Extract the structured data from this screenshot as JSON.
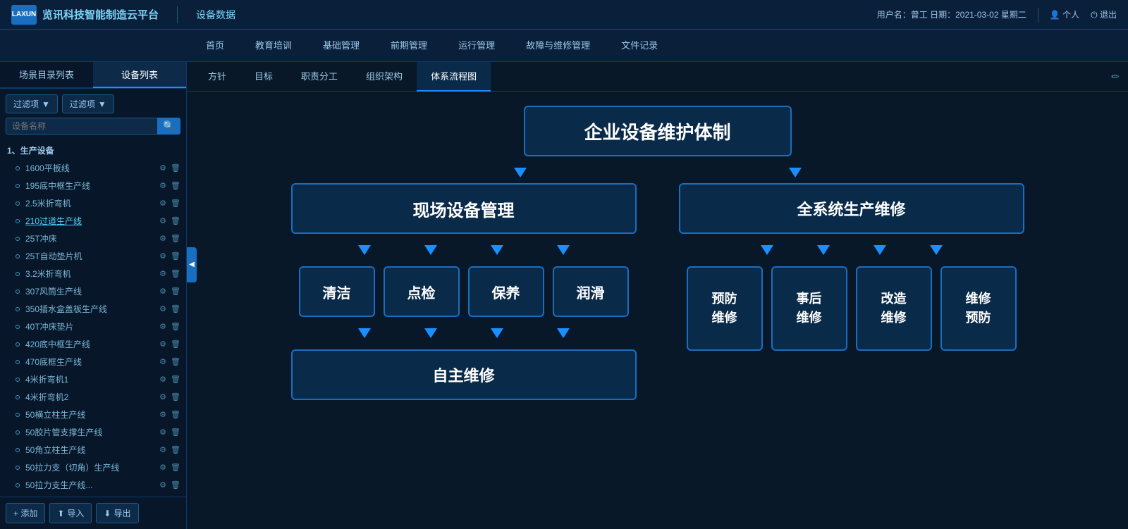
{
  "header": {
    "logo_text": "LAXUN",
    "app_title": "览讯科技智能制造云平台",
    "page_label": "设备数据",
    "user_info": "用户名：曾工  日期：2021-03-02 星期二",
    "personal_label": "个人",
    "logout_label": "退出"
  },
  "nav": {
    "tabs": [
      {
        "label": "首页",
        "active": false
      },
      {
        "label": "教育培训",
        "active": false
      },
      {
        "label": "基础管理",
        "active": false
      },
      {
        "label": "前期管理",
        "active": false
      },
      {
        "label": "运行管理",
        "active": false
      },
      {
        "label": "故障与维修管理",
        "active": false
      },
      {
        "label": "文件记录",
        "active": false
      }
    ]
  },
  "sidebar": {
    "filter1_label": "过滤项",
    "filter2_label": "过滤项",
    "search_placeholder": "设备名称",
    "group_label": "1、生产设备",
    "items": [
      {
        "name": "1600平板线"
      },
      {
        "name": "195底中框生产线"
      },
      {
        "name": "2.5米折弯机"
      },
      {
        "name": "210过道生产线",
        "highlight": true
      },
      {
        "name": "25T冲床"
      },
      {
        "name": "25T自动垫片机"
      },
      {
        "name": "3.2米折弯机"
      },
      {
        "name": "307风筒生产线"
      },
      {
        "name": "350插水盒盖板生产线"
      },
      {
        "name": "40T冲床垫片"
      },
      {
        "name": "420底中框生产线"
      },
      {
        "name": "470底框生产线"
      },
      {
        "name": "4米折弯机1"
      },
      {
        "name": "4米折弯机2"
      },
      {
        "name": "50横立柱生产线"
      },
      {
        "name": "50胶片管支撑生产线"
      },
      {
        "name": "50角立柱生产线"
      },
      {
        "name": "50拉力支（切角）生产线"
      },
      {
        "name": "50拉力支生产线..."
      }
    ],
    "add_label": "+ 添加",
    "import_label": "导入",
    "export_label": "导出"
  },
  "sub_tabs": {
    "tabs": [
      {
        "label": "方针",
        "active": false
      },
      {
        "label": "目标",
        "active": false
      },
      {
        "label": "职责分工",
        "active": false
      },
      {
        "label": "组织架构",
        "active": false
      },
      {
        "label": "体系流程图",
        "active": true
      }
    ]
  },
  "flow": {
    "title_box": "企业设备维护体制",
    "left_branch_box": "现场设备管理",
    "right_branch_box": "全系统生产维修",
    "left_items": [
      "清洁",
      "点检",
      "保养",
      "润滑"
    ],
    "left_bottom_box": "自主维修",
    "right_items": [
      "预防\n维修",
      "事后\n维修",
      "改造\n维修",
      "维修\n预防"
    ]
  }
}
